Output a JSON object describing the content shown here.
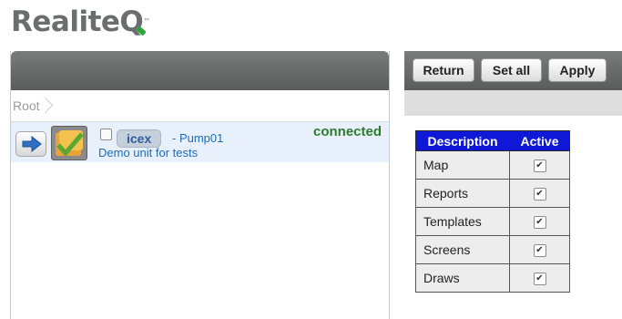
{
  "logo": {
    "text_main": "Realite",
    "text_q": "Q",
    "tm": "™"
  },
  "breadcrumb": {
    "root": "Root"
  },
  "unit": {
    "tag": "icex",
    "name": "- Pump01",
    "description": "Demo unit for tests",
    "status": "connected"
  },
  "toolbar": {
    "return_label": "Return",
    "set_all_label": "Set all",
    "apply_label": "Apply"
  },
  "permissions": {
    "headers": {
      "description": "Description",
      "active": "Active"
    },
    "rows": [
      {
        "label": "Map",
        "active": true
      },
      {
        "label": "Reports",
        "active": true
      },
      {
        "label": "Templates",
        "active": true
      },
      {
        "label": "Screens",
        "active": true
      },
      {
        "label": "Draws",
        "active": true
      }
    ],
    "check_glyph": "✔"
  },
  "colors": {
    "header_blue": "#1018d8",
    "status_green": "#2e7a2e",
    "link_blue": "#1e6bb8"
  }
}
